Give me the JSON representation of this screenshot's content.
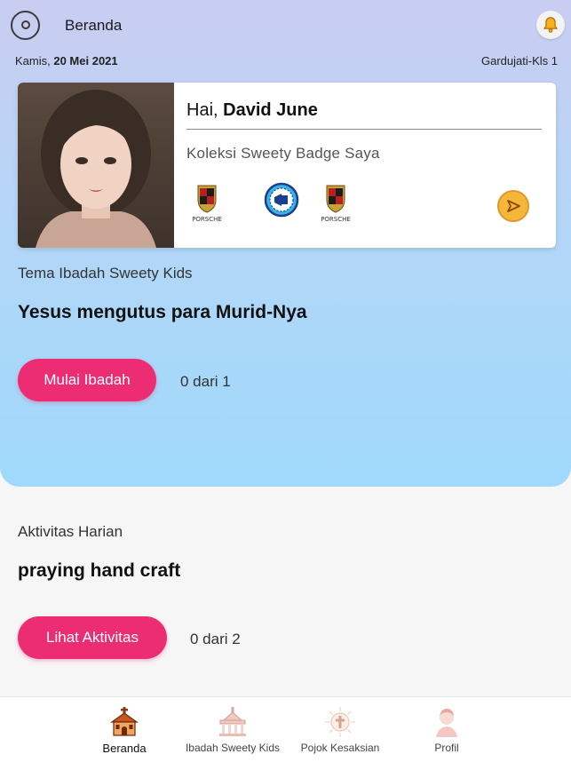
{
  "header": {
    "title": "Beranda",
    "date_prefix": "Kamis,",
    "date_value": "20 Mei 2021",
    "location": "Gardujati-Kls 1"
  },
  "profile_card": {
    "greeting_prefix": "Hai,",
    "user_name": "David June",
    "badge_collection_title": "Koleksi Sweety Badge Saya",
    "badges": [
      {
        "icon": "porsche-crest-badge-icon",
        "caption": "PORSCHE"
      },
      {
        "icon": "megaphone-badge-icon",
        "caption": ""
      },
      {
        "icon": "porsche-crest-badge-icon",
        "caption": "PORSCHE"
      }
    ],
    "send_icon": "send-arrow-icon"
  },
  "worship": {
    "label": "Tema Ibadah Sweety Kids",
    "title": "Yesus mengutus para Murid-Nya",
    "button_label": "Mulai Ibadah",
    "progress_text": "0 dari 1"
  },
  "activity": {
    "label": "Aktivitas Harian",
    "title": "praying hand craft",
    "button_label": "Lihat Aktivitas",
    "progress_text": "0 dari 2"
  },
  "bottom_nav": {
    "items": [
      {
        "label": "Beranda",
        "icon": "church-icon",
        "active": true
      },
      {
        "label": "Ibadah Sweety Kids",
        "icon": "temple-icon",
        "active": false
      },
      {
        "label": "Pojok Kesaksian",
        "icon": "cross-sun-icon",
        "active": false
      },
      {
        "label": "Profil",
        "icon": "person-icon",
        "active": false
      }
    ]
  },
  "colors": {
    "accent_pink": "#ec2d73",
    "hero_top": "#c9cdf1",
    "hero_bottom": "#9fd9fb",
    "send_button": "#f5b73a"
  }
}
